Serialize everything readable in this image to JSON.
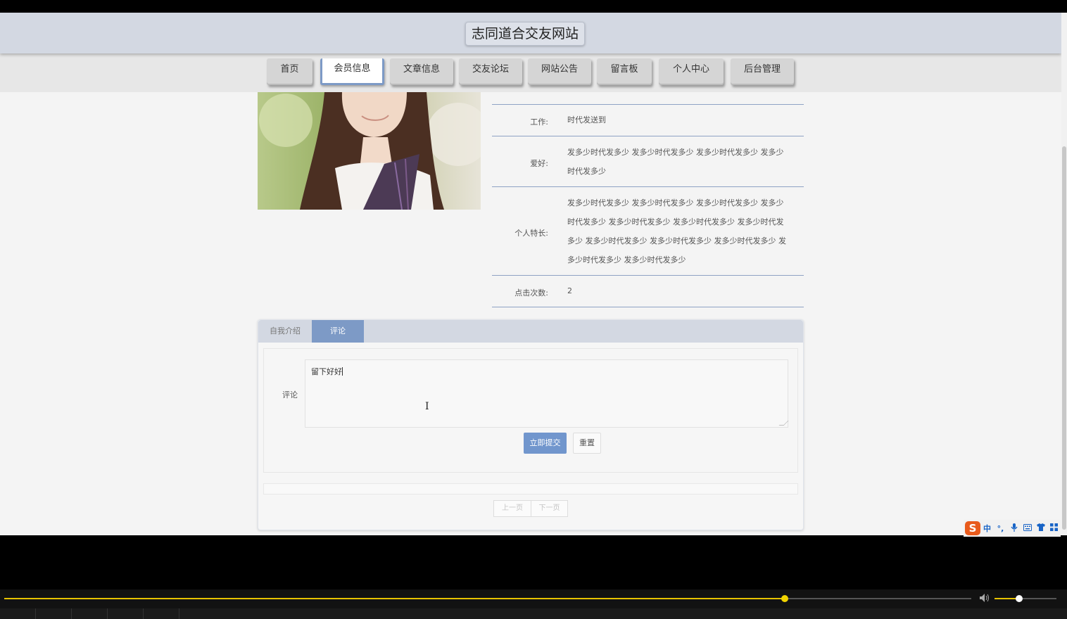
{
  "site": {
    "title": "志同道合交友网站"
  },
  "nav": {
    "items": [
      {
        "label": "首页"
      },
      {
        "label": "会员信息",
        "active": true
      },
      {
        "label": "文章信息"
      },
      {
        "label": "交友论坛"
      },
      {
        "label": "网站公告"
      },
      {
        "label": "留言板"
      },
      {
        "label": "个人中心"
      },
      {
        "label": "后台管理"
      }
    ]
  },
  "profile": {
    "rows": [
      {
        "label": "工作:",
        "value": "时代发送到"
      },
      {
        "label": "爱好:",
        "value": "发多少时代发多少 发多少时代发多少 发多少时代发多少 发多少时代发多少"
      },
      {
        "label": "个人特长:",
        "value": "发多少时代发多少 发多少时代发多少 发多少时代发多少 发多少时代发多少 发多少时代发多少 发多少时代发多少 发多少时代发多少 发多少时代发多少 发多少时代发多少 发多少时代发多少 发多少时代发多少 发多少时代发多少"
      },
      {
        "label": "点击次数:",
        "value": "2"
      }
    ]
  },
  "tabs": [
    {
      "label": "自我介绍"
    },
    {
      "label": "评论",
      "active": true
    }
  ],
  "comment_form": {
    "label": "评论",
    "value": "留下好好",
    "submit_label": "立即提交",
    "reset_label": "重置"
  },
  "pager": {
    "prev_label": "上一页",
    "next_label": "下一页"
  },
  "ime": {
    "logo": "S",
    "icons": [
      "中",
      "°,",
      "mic-icon",
      "keyboard-icon",
      "shirt-icon",
      "grid-icon"
    ]
  },
  "player": {
    "progress": 0.807,
    "volume": 0.4
  },
  "colors": {
    "accent": "#7d9ac6",
    "submit": "#7196cd",
    "header": "#d3d8e2",
    "progress": "#e8c400"
  }
}
